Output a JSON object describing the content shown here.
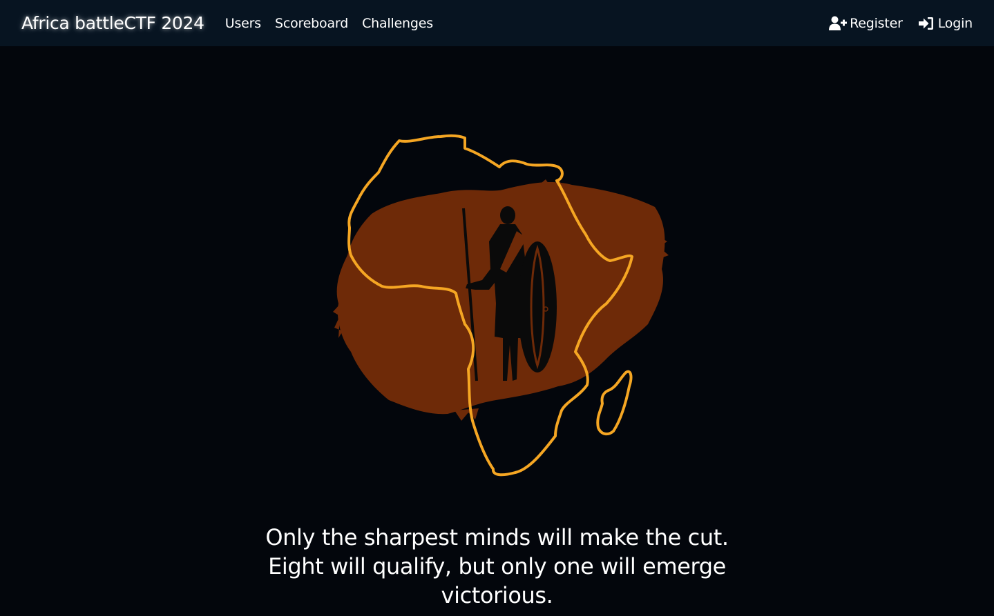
{
  "navbar": {
    "brand": "Africa battleCTF 2024",
    "links": [
      {
        "label": "Users"
      },
      {
        "label": "Scoreboard"
      },
      {
        "label": "Challenges"
      }
    ],
    "right": [
      {
        "label": "Register",
        "icon": "user-plus-icon"
      },
      {
        "label": "Login",
        "icon": "sign-in-icon"
      }
    ]
  },
  "hero": {
    "logo": "africa-warrior-logo",
    "colors": {
      "outline": "#f5a623",
      "brush": "#6e2a08",
      "figure": "#0a0a0a"
    }
  },
  "tagline": {
    "line1": "Only the sharpest minds will make the cut.",
    "line2": "Eight will qualify, but only one will emerge",
    "line3": "victorious."
  },
  "colors": {
    "background": "#03060c",
    "navbar": "#071421",
    "text": "#ffffff"
  }
}
